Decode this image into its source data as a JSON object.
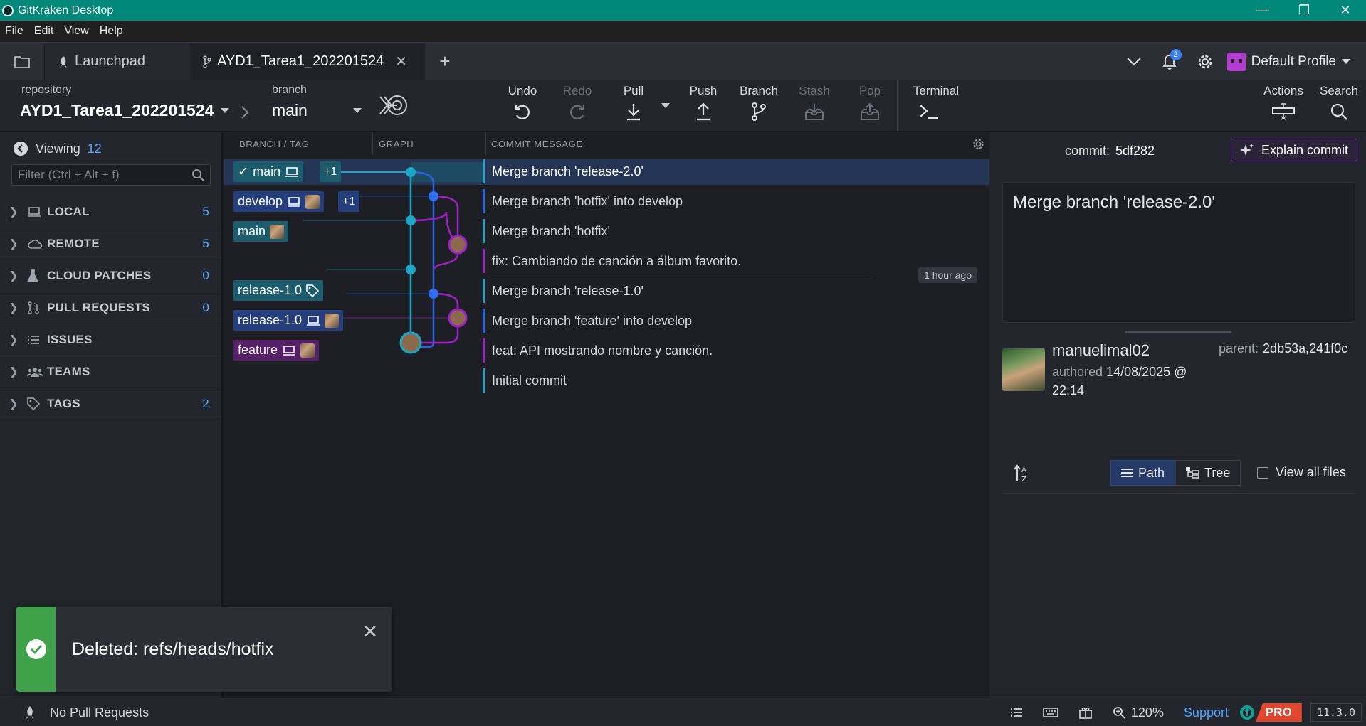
{
  "window": {
    "title": "GitKraken Desktop"
  },
  "menu": [
    "File",
    "Edit",
    "View",
    "Help"
  ],
  "tabs": {
    "launchpad": "Launchpad",
    "repo": "AYD1_Tarea1_202201524",
    "notifications_count": "2",
    "profile": "Default Profile"
  },
  "toolbar": {
    "repository_label": "repository",
    "repository_value": "AYD1_Tarea1_202201524",
    "branch_label": "branch",
    "branch_value": "main",
    "undo": "Undo",
    "redo": "Redo",
    "pull": "Pull",
    "push": "Push",
    "branch": "Branch",
    "stash": "Stash",
    "pop": "Pop",
    "terminal": "Terminal",
    "actions": "Actions",
    "search": "Search"
  },
  "sidebar": {
    "viewing_label": "Viewing",
    "viewing_count": "12",
    "filter_placeholder": "Filter (Ctrl + Alt + f)",
    "sections": [
      {
        "label": "LOCAL",
        "count": "5",
        "icon": "laptop-icon"
      },
      {
        "label": "REMOTE",
        "count": "5",
        "icon": "cloud-icon"
      },
      {
        "label": "CLOUD PATCHES",
        "count": "0",
        "icon": "flask-icon"
      },
      {
        "label": "PULL REQUESTS",
        "count": "0",
        "icon": "pull-request-icon"
      },
      {
        "label": "ISSUES",
        "count": "",
        "icon": "list-icon"
      },
      {
        "label": "TEAMS",
        "count": "",
        "icon": "team-icon"
      },
      {
        "label": "TAGS",
        "count": "2",
        "icon": "tag-icon"
      }
    ]
  },
  "graph": {
    "headers": {
      "branch_tag": "BRANCH / TAG",
      "graph": "GRAPH",
      "commit_message": "COMMIT MESSAGE"
    },
    "refs": {
      "main_local": "main",
      "main_plus": "+1",
      "develop": "develop",
      "develop_plus": "+1",
      "main_remote": "main",
      "release_tag": "release-1.0",
      "release_branch": "release-1.0",
      "feature": "feature"
    },
    "commits": [
      "Merge branch 'release-2.0'",
      "Merge branch 'hotfix' into develop",
      "Merge branch 'hotfix'",
      "fix: Cambiando de canción a álbum favorito.",
      "Merge branch 'release-1.0'",
      "Merge branch 'feature' into develop",
      "feat: API mostrando nombre y canción.",
      "Initial commit"
    ],
    "timestamp": "1 hour ago"
  },
  "commit_panel": {
    "commit_label": "commit:",
    "commit_sha": "5df282",
    "explain_button": "Explain commit",
    "message": "Merge branch 'release-2.0'",
    "author": "manuelimal02",
    "authored_label": "authored",
    "authored_date": "14/08/2025 @ 22:14",
    "parent_label": "parent:",
    "parent_value": "2db53a,241f0c",
    "path_button": "Path",
    "tree_button": "Tree",
    "view_all_files": "View all files"
  },
  "toast": {
    "message": "Deleted: refs/heads/hotfix"
  },
  "statusbar": {
    "pull_requests": "No Pull Requests",
    "zoom": "120%",
    "support": "Support",
    "pro": "PRO",
    "version": "11.3.0"
  },
  "colors": {
    "title_bar": "#00897b",
    "accent_blue": "#4ea3ff",
    "graph_teal": "#1ca7c7",
    "graph_blue": "#2563eb",
    "graph_purple": "#a020c8",
    "pro_badge": "#e1462e",
    "toast_success": "#3fa24a"
  }
}
